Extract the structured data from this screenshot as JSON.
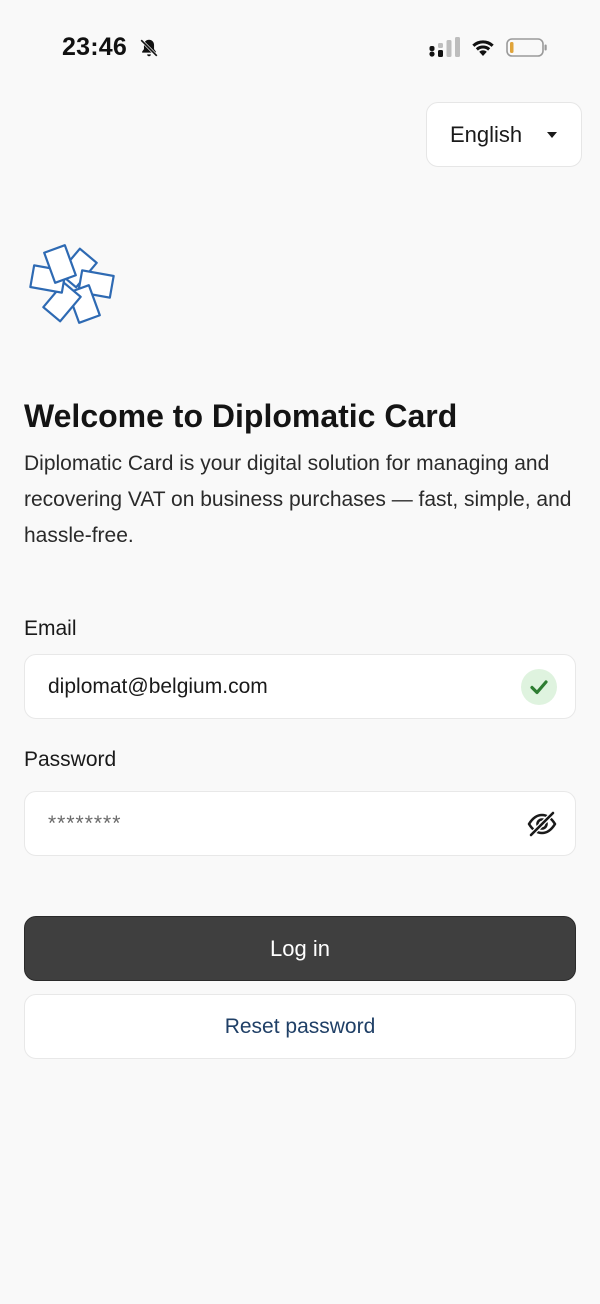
{
  "status_bar": {
    "time": "23:46",
    "icons": [
      "bell-slash-icon",
      "cellular-signal-icon",
      "wifi-icon",
      "battery-low-icon"
    ]
  },
  "language_selector": {
    "selected": "English",
    "icon": "caret-down-icon"
  },
  "logo": {
    "icon": "diplomatic-card-logo-icon",
    "color": "#2e6ab3"
  },
  "welcome": {
    "title": "Welcome to Diplomatic Card",
    "description": "Diplomatic Card is your digital solution for managing and recovering VAT on business purchases — fast, simple, and hassle-free."
  },
  "form": {
    "email": {
      "label": "Email",
      "value": "diplomat@belgium.com",
      "status_icon": "check-icon",
      "status_color": "#2e7d32"
    },
    "password": {
      "label": "Password",
      "value": "********",
      "toggle_icon": "eye-slash-icon"
    }
  },
  "actions": {
    "login_label": "Log in",
    "reset_label": "Reset password"
  },
  "colors": {
    "background": "#f9f9f9",
    "primary_button": "#3f3f3f",
    "link_text": "#1f3f66",
    "success_badge": "#dff3df"
  }
}
